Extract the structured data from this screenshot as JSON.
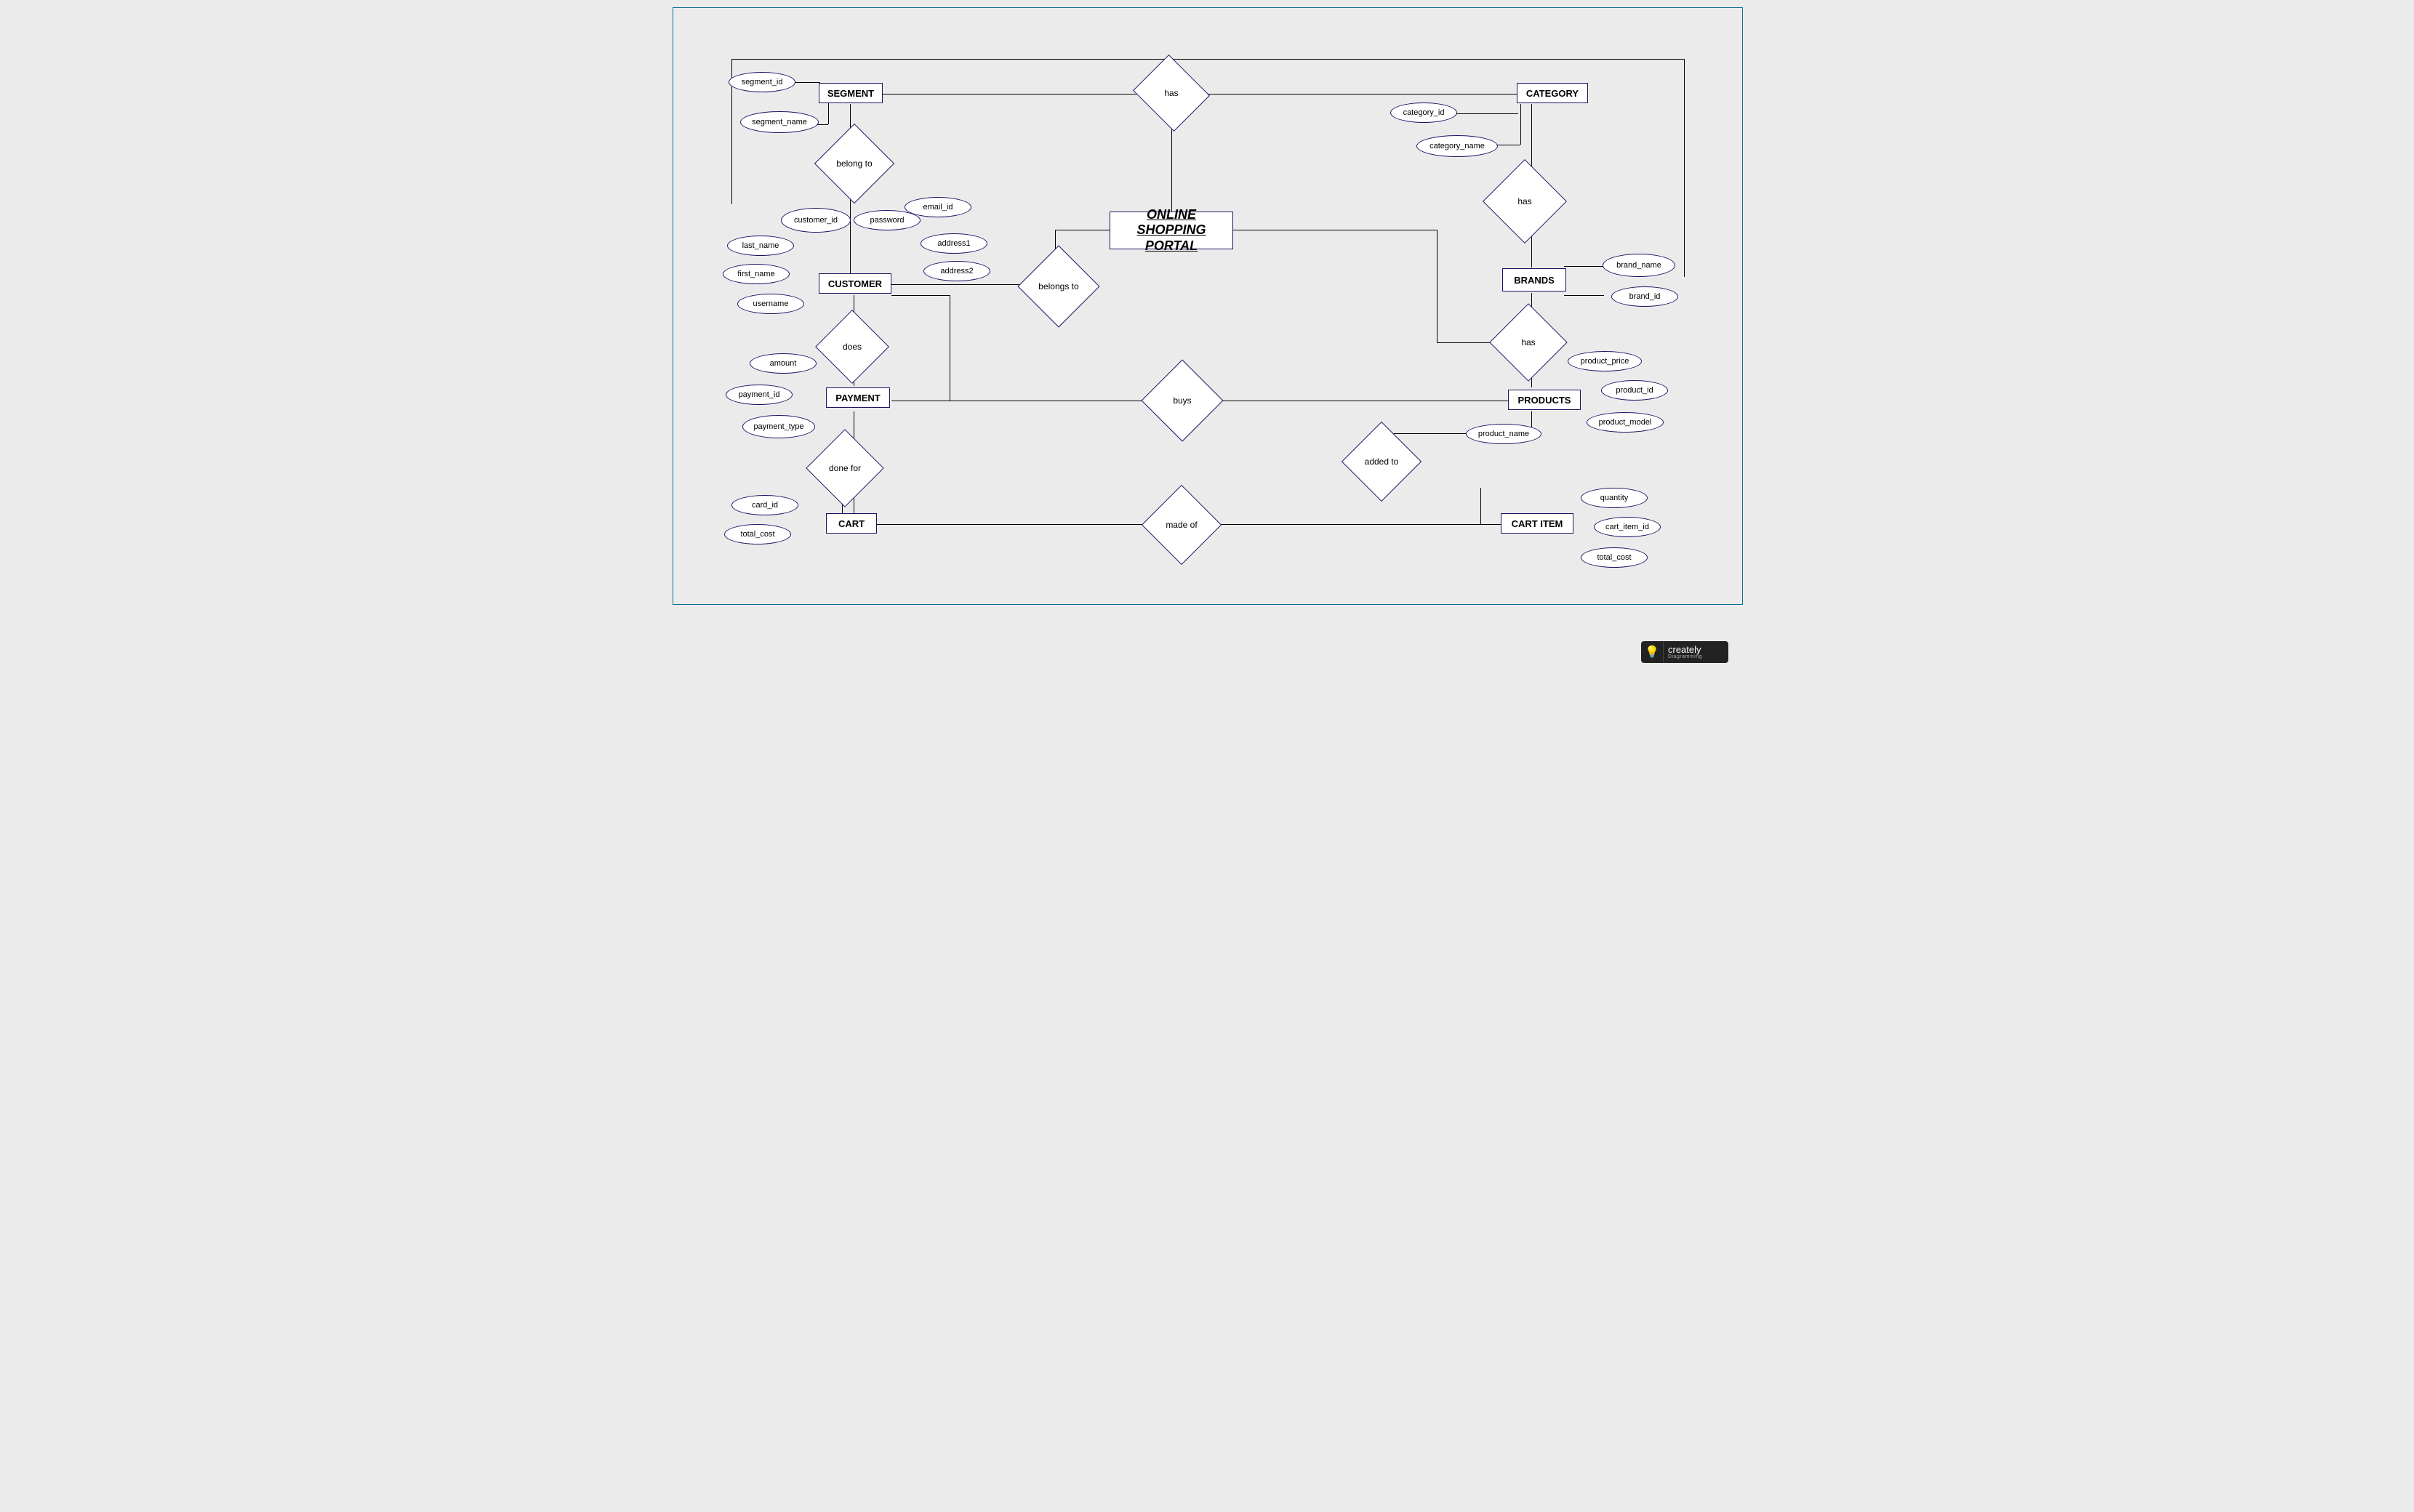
{
  "title": "ONLINE SHOPPING PORTAL",
  "entities": {
    "segment": "SEGMENT",
    "category": "CATEGORY",
    "customer": "CUSTOMER",
    "brands": "BRANDS",
    "payment": "PAYMENT",
    "products": "PRODUCTS",
    "cart": "CART",
    "cart_item": "CART ITEM"
  },
  "relationships": {
    "has_top": "has",
    "belong_to": "belong to",
    "has_category": "has",
    "belongs_to": "belongs to",
    "does": "does",
    "buys": "buys",
    "has_brand": "has",
    "done_for": "done for",
    "made_of": "made of",
    "added_to": "added to"
  },
  "attributes": {
    "segment_id": "segment_id",
    "segment_name": "segment_name",
    "category_id": "category_id",
    "category_name": "category_name",
    "customer_id": "customer_id",
    "password": "password",
    "email_id": "email_id",
    "last_name": "last_name",
    "address1": "address1",
    "first_name": "first_name",
    "address2": "address2",
    "username": "username",
    "brand_name": "brand_name",
    "brand_id": "brand_id",
    "amount": "amount",
    "payment_id": "payment_id",
    "payment_type": "payment_type",
    "product_price": "product_price",
    "product_id": "product_id",
    "product_model": "product_model",
    "product_name": "product_name",
    "card_id": "card_id",
    "total_cost_cart": "total_cost",
    "quantity": "quantity",
    "cart_item_id": "cart_item_id",
    "total_cost_item": "total_cost"
  },
  "logo": {
    "brand": "creately",
    "sub": "Diagramming"
  }
}
